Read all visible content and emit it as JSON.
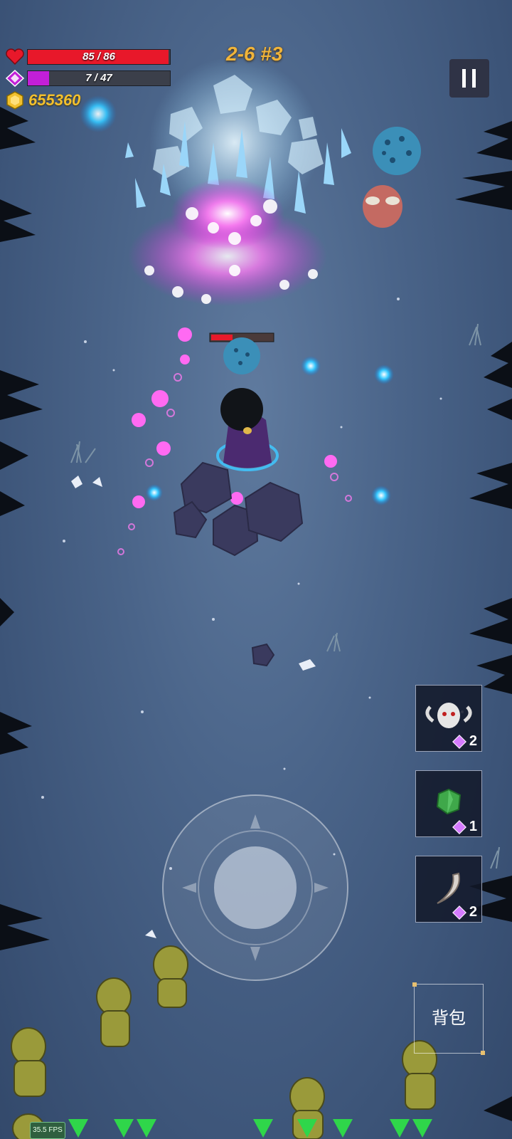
{
  "hud": {
    "hp_text": "85 / 86",
    "hp_fraction": 0.988,
    "hp_color": "#e8182a",
    "mana_text": "7 / 47",
    "mana_fraction": 0.149,
    "mana_color": "#c21fd8",
    "gold": "655360",
    "gold_icon": "hexagon-coin-icon",
    "heart_icon": "heart-icon",
    "mana_icon": "diamond-gem-icon"
  },
  "stage": {
    "label": "2-6 #3"
  },
  "pause": {
    "icon": "pause-icon"
  },
  "items": [
    {
      "icon": "horned-skull-icon",
      "count": "2"
    },
    {
      "icon": "green-crystal-icon",
      "count": "1"
    },
    {
      "icon": "horn-tusk-icon",
      "count": "2"
    }
  ],
  "bag": {
    "label": "背包"
  },
  "fps": {
    "label": "35.5 FPS"
  },
  "joystick": {
    "icon": "virtual-joystick"
  },
  "colors": {
    "ground": "#4a6489",
    "magic_pink": "#ff5cf0",
    "ice": "#bfe6ff"
  }
}
